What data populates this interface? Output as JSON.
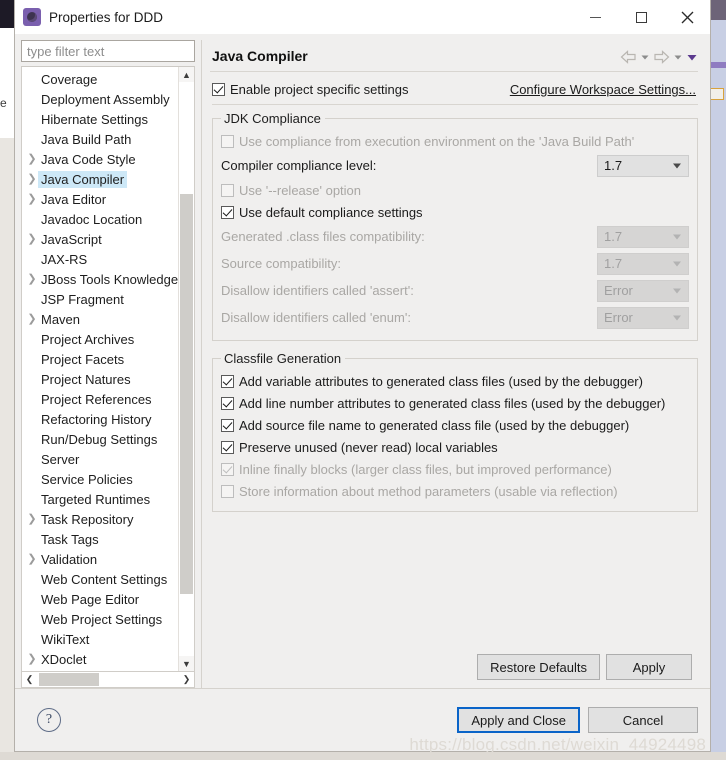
{
  "window": {
    "title": "Properties for DDD",
    "icon": "eclipse-properties-icon",
    "minimize_label": "Minimize",
    "maximize_label": "Maximize",
    "close_label": "Close"
  },
  "sidebar": {
    "filter_placeholder": "type filter text",
    "filter_value": "",
    "items": [
      {
        "label": "Coverage",
        "expandable": false,
        "selected": false
      },
      {
        "label": "Deployment Assembly",
        "expandable": false,
        "selected": false
      },
      {
        "label": "Hibernate Settings",
        "expandable": false,
        "selected": false
      },
      {
        "label": "Java Build Path",
        "expandable": false,
        "selected": false
      },
      {
        "label": "Java Code Style",
        "expandable": true,
        "selected": false
      },
      {
        "label": "Java Compiler",
        "expandable": true,
        "selected": true
      },
      {
        "label": "Java Editor",
        "expandable": true,
        "selected": false
      },
      {
        "label": "Javadoc Location",
        "expandable": false,
        "selected": false
      },
      {
        "label": "JavaScript",
        "expandable": true,
        "selected": false
      },
      {
        "label": "JAX-RS",
        "expandable": false,
        "selected": false
      },
      {
        "label": "JBoss Tools Knowledge",
        "expandable": true,
        "selected": false
      },
      {
        "label": "JSP Fragment",
        "expandable": false,
        "selected": false
      },
      {
        "label": "Maven",
        "expandable": true,
        "selected": false
      },
      {
        "label": "Project Archives",
        "expandable": false,
        "selected": false
      },
      {
        "label": "Project Facets",
        "expandable": false,
        "selected": false
      },
      {
        "label": "Project Natures",
        "expandable": false,
        "selected": false
      },
      {
        "label": "Project References",
        "expandable": false,
        "selected": false
      },
      {
        "label": "Refactoring History",
        "expandable": false,
        "selected": false
      },
      {
        "label": "Run/Debug Settings",
        "expandable": false,
        "selected": false
      },
      {
        "label": "Server",
        "expandable": false,
        "selected": false
      },
      {
        "label": "Service Policies",
        "expandable": false,
        "selected": false
      },
      {
        "label": "Targeted Runtimes",
        "expandable": false,
        "selected": false
      },
      {
        "label": "Task Repository",
        "expandable": true,
        "selected": false
      },
      {
        "label": "Task Tags",
        "expandable": false,
        "selected": false
      },
      {
        "label": "Validation",
        "expandable": true,
        "selected": false
      },
      {
        "label": "Web Content Settings",
        "expandable": false,
        "selected": false
      },
      {
        "label": "Web Page Editor",
        "expandable": false,
        "selected": false
      },
      {
        "label": "Web Project Settings",
        "expandable": false,
        "selected": false
      },
      {
        "label": "WikiText",
        "expandable": false,
        "selected": false
      },
      {
        "label": "XDoclet",
        "expandable": true,
        "selected": false
      }
    ]
  },
  "panel": {
    "title": "Java Compiler",
    "nav": {
      "back_label": "Back",
      "back_menu_label": "Back history",
      "forward_label": "Forward",
      "forward_menu_label": "Forward history",
      "view_menu_label": "View menu"
    },
    "enable_specific": {
      "label": "Enable project specific settings",
      "checked": true,
      "enabled": true
    },
    "configure_workspace_link": "Configure Workspace Settings...",
    "jdk_compliance": {
      "legend": "JDK Compliance",
      "use_execution_env": {
        "label": "Use compliance from execution environment on the 'Java Build Path'",
        "checked": false,
        "enabled": false
      },
      "compliance_level": {
        "label": "Compiler compliance level:",
        "value": "1.7",
        "enabled": true
      },
      "use_release_option": {
        "label": "Use '--release' option",
        "checked": false,
        "enabled": false
      },
      "use_default_compliance": {
        "label": "Use default compliance settings",
        "checked": true,
        "enabled": true
      },
      "generated_class_compat": {
        "label": "Generated .class files compatibility:",
        "value": "1.7",
        "enabled": false
      },
      "source_compat": {
        "label": "Source compatibility:",
        "value": "1.7",
        "enabled": false
      },
      "disallow_assert": {
        "label": "Disallow identifiers called 'assert':",
        "value": "Error",
        "enabled": false
      },
      "disallow_enum": {
        "label": "Disallow identifiers called 'enum':",
        "value": "Error",
        "enabled": false
      }
    },
    "classfile_generation": {
      "legend": "Classfile Generation",
      "options": [
        {
          "label": "Add variable attributes to generated class files (used by the debugger)",
          "checked": true,
          "enabled": true
        },
        {
          "label": "Add line number attributes to generated class files (used by the debugger)",
          "checked": true,
          "enabled": true
        },
        {
          "label": "Add source file name to generated class file (used by the debugger)",
          "checked": true,
          "enabled": true
        },
        {
          "label": "Preserve unused (never read) local variables",
          "checked": true,
          "enabled": true
        },
        {
          "label": "Inline finally blocks (larger class files, but improved performance)",
          "checked": true,
          "enabled": false
        },
        {
          "label": "Store information about method parameters (usable via reflection)",
          "checked": false,
          "enabled": false
        }
      ]
    },
    "buttons": {
      "restore_defaults": "Restore Defaults",
      "apply": "Apply"
    }
  },
  "footer": {
    "help_glyph": "?",
    "apply_and_close": "Apply and Close",
    "cancel": "Cancel"
  },
  "watermark": "https://blog.csdn.net/weixin_44924498",
  "background": {
    "left_fragment": "e"
  },
  "colors": {
    "accent_selection": "#cde8f7",
    "primary_button_border": "#0a64c8",
    "dialog_background": "#f0efee",
    "title_icon": "#7a5fae",
    "disabled_text": "#a9a7a4"
  }
}
